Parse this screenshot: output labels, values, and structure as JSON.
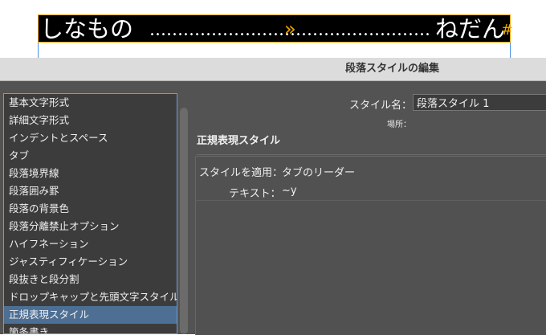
{
  "document": {
    "sample_left": "しなもの",
    "sample_right": "ねだん",
    "tab_marker": "»",
    "end_marker": "#"
  },
  "dialog": {
    "title": "段落スタイルの編集",
    "categories": [
      "基本文字形式",
      "詳細文字形式",
      "インデントとスペース",
      "タブ",
      "段落境界線",
      "段落囲み罫",
      "段落の背景色",
      "段落分離禁止オプション",
      "ハイフネーション",
      "ジャスティフィケーション",
      "段抜きと段分割",
      "ドロップキャップと先頭文字スタイル",
      "正規表現スタイル",
      "箇条書き"
    ],
    "selected_category": "正規表現スタイル",
    "style_name_label": "スタイル名：",
    "style_name_value": "段落スタイル 1",
    "location_label": "場所：",
    "section_title": "正規表現スタイル",
    "apply_style_label": "スタイルを適用：",
    "apply_style_value": "タブのリーダー",
    "text_label": "テキスト：",
    "text_value": "~y"
  },
  "colors": {
    "selection": "#4d6f94",
    "marker": "#f0a500",
    "frame": "#4a90e2",
    "panel": "#535353"
  }
}
